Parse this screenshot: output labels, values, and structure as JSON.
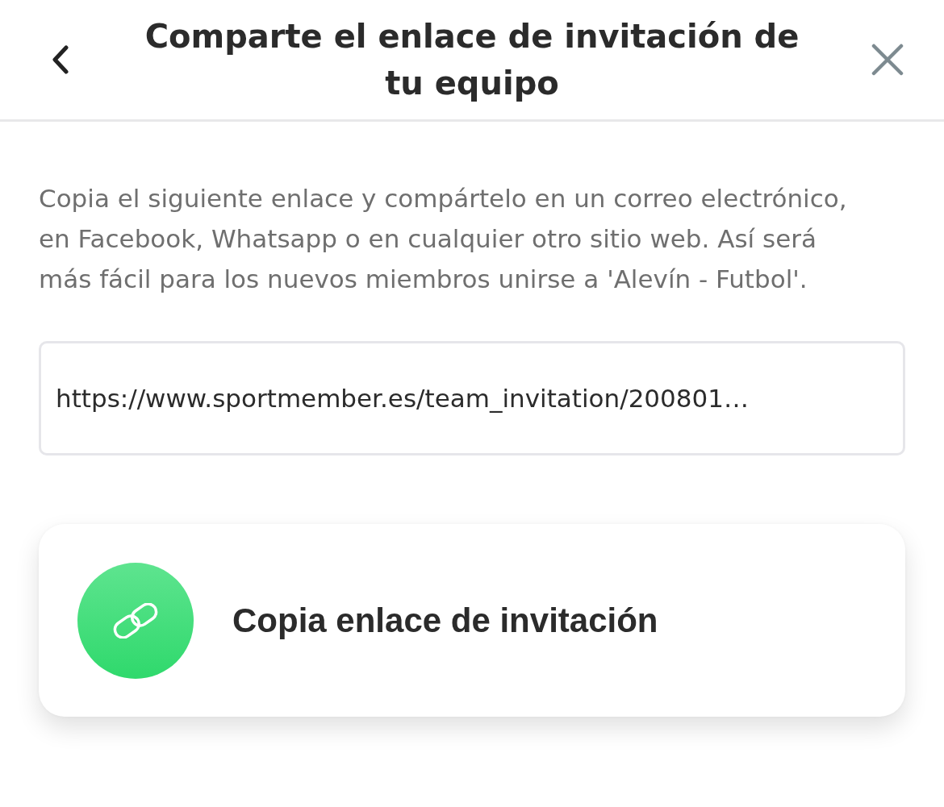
{
  "header": {
    "title": "Comparte el enlace de invitación de tu equipo"
  },
  "description": "Copia el siguiente enlace y compártelo en un correo electrónico, en Facebook, Whatsapp o en cualquier otro sitio web. Así será más fácil para los nuevos miembros unirse a 'Alevín - Futbol'.",
  "link_field": {
    "value": "https://www.sportmember.es/team_invitation/200801…"
  },
  "copy_button": {
    "label": "Copia enlace de invitación"
  }
}
